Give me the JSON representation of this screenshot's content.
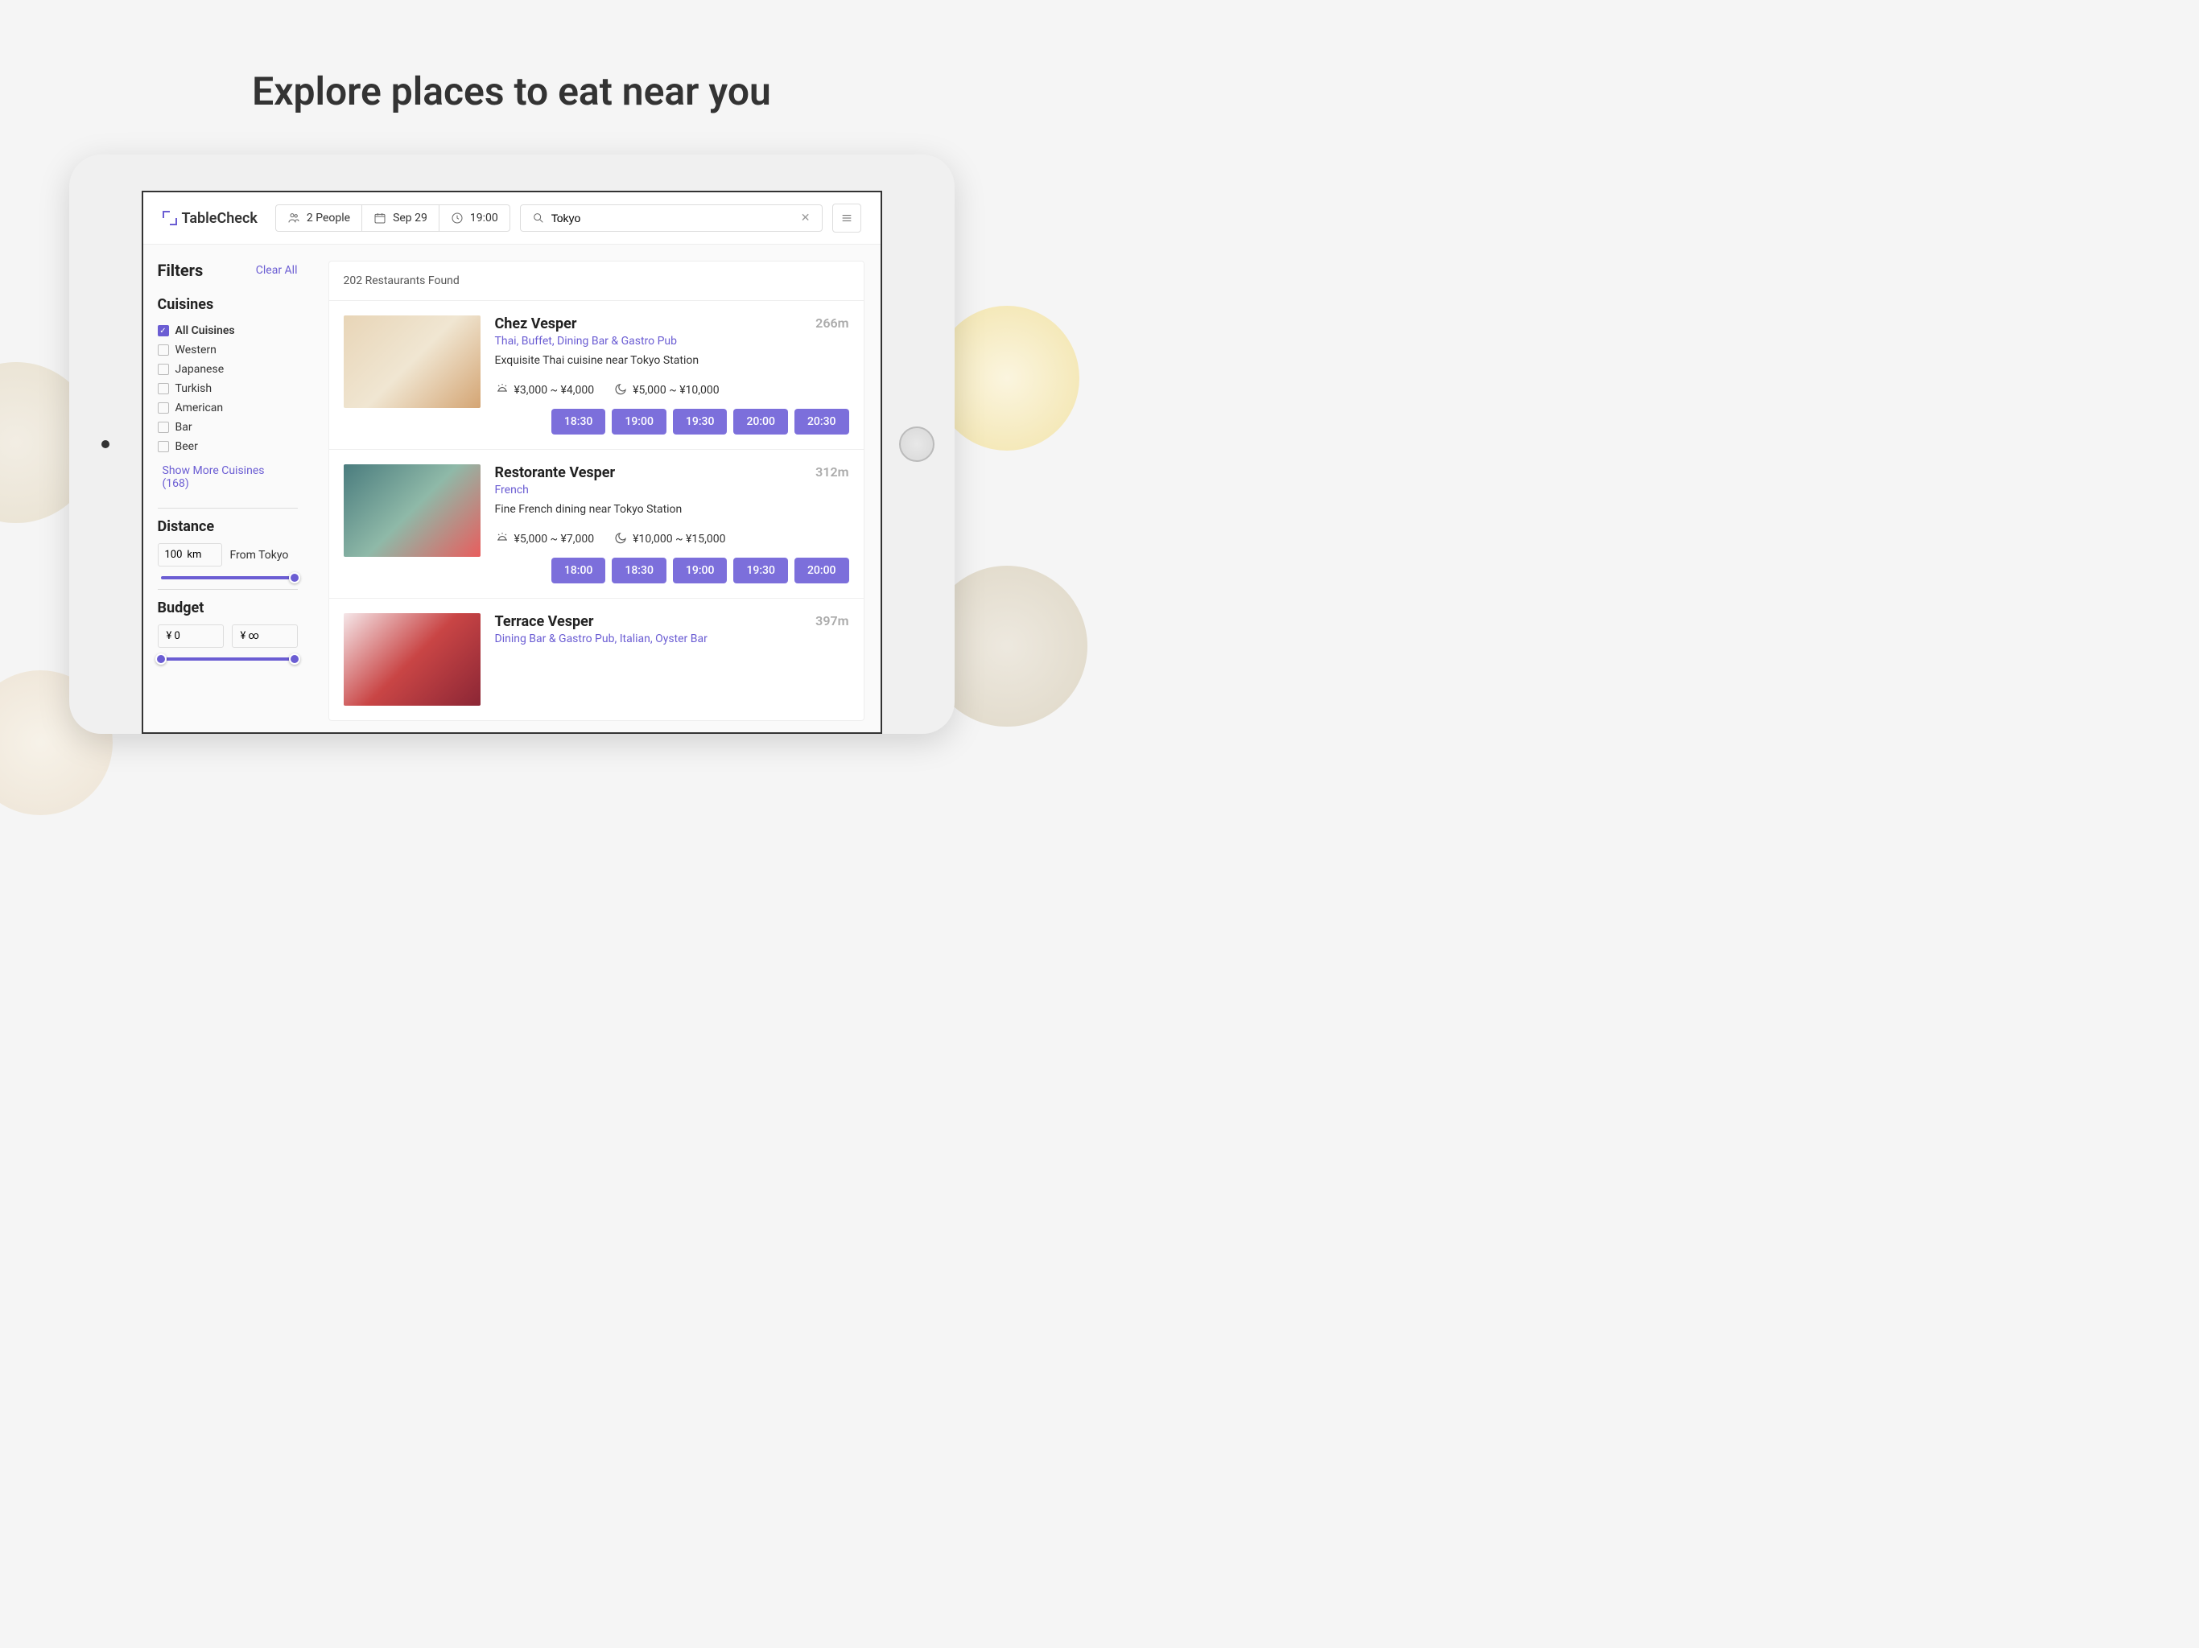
{
  "hero": {
    "title": "Explore places to eat near you"
  },
  "logo": {
    "text": "TableCheck"
  },
  "search": {
    "people": "2 People",
    "date": "Sep 29",
    "time": "19:00",
    "location": "Tokyo"
  },
  "filters": {
    "title": "Filters",
    "clear": "Clear All",
    "cuisines": {
      "title": "Cuisines",
      "items": [
        {
          "label": "All Cuisines",
          "checked": true
        },
        {
          "label": "Western",
          "checked": false
        },
        {
          "label": "Japanese",
          "checked": false
        },
        {
          "label": "Turkish",
          "checked": false
        },
        {
          "label": "American",
          "checked": false
        },
        {
          "label": "Bar",
          "checked": false
        },
        {
          "label": "Beer",
          "checked": false
        }
      ],
      "show_more": "Show More Cuisines (168)"
    },
    "distance": {
      "title": "Distance",
      "value": "100",
      "unit": "km",
      "from": "From Tokyo"
    },
    "budget": {
      "title": "Budget",
      "min": "¥ 0",
      "max": "¥ ∞"
    }
  },
  "results": {
    "count": "202 Restaurants Found",
    "items": [
      {
        "name": "Chez Vesper",
        "distance": "266m",
        "tags": "Thai, Buffet, Dining Bar & Gastro Pub",
        "desc": "Exquisite Thai cuisine near Tokyo Station",
        "lunch": "¥3,000 ~ ¥4,000",
        "dinner": "¥5,000 ~ ¥10,000",
        "img": "breakfast",
        "slots": [
          "18:30",
          "19:00",
          "19:30",
          "20:00",
          "20:30"
        ]
      },
      {
        "name": "Restorante Vesper",
        "distance": "312m",
        "tags": "French",
        "desc": "Fine French dining near Tokyo Station",
        "lunch": "¥5,000 ~ ¥7,000",
        "dinner": "¥10,000 ~ ¥15,000",
        "img": "french",
        "slots": [
          "18:00",
          "18:30",
          "19:00",
          "19:30",
          "20:00"
        ]
      },
      {
        "name": "Terrace Vesper",
        "distance": "397m",
        "tags": "Dining Bar & Gastro Pub, Italian, Oyster Bar",
        "desc": "",
        "lunch": "",
        "dinner": "",
        "img": "dessert",
        "slots": []
      }
    ]
  }
}
